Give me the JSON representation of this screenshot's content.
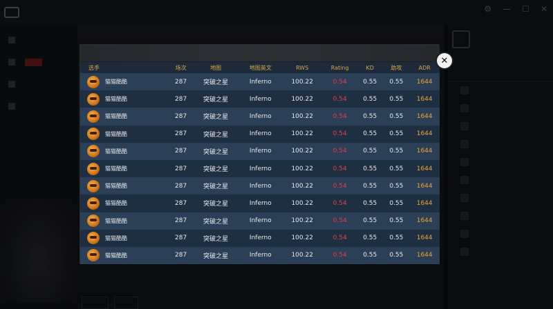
{
  "app": {
    "nav": [
      "",
      "",
      "",
      "",
      "",
      ""
    ],
    "window_controls": [
      "⚙",
      "—",
      "☐",
      "✕"
    ]
  },
  "modal": {
    "close_label": "✕",
    "columns": {
      "player": "选手",
      "matches": "场次",
      "map": "地图",
      "map_en": "地图英文",
      "rws": "RWS",
      "rating": "Rating",
      "kd": "KD",
      "assist": "助攻",
      "adr": "ADR"
    },
    "rows": [
      {
        "player": "猫猫酷酷",
        "matches": "287",
        "map": "突破之星",
        "map_en": "Inferno",
        "rws": "100.22",
        "rating": "0.54",
        "kd": "0.55",
        "assist": "0.55",
        "adr": "1644"
      },
      {
        "player": "猫猫酷酷",
        "matches": "287",
        "map": "突破之星",
        "map_en": "Inferno",
        "rws": "100.22",
        "rating": "0.54",
        "kd": "0.55",
        "assist": "0.55",
        "adr": "1644"
      },
      {
        "player": "猫猫酷酷",
        "matches": "287",
        "map": "突破之星",
        "map_en": "Inferno",
        "rws": "100.22",
        "rating": "0.54",
        "kd": "0.55",
        "assist": "0.55",
        "adr": "1644"
      },
      {
        "player": "猫猫酷酷",
        "matches": "287",
        "map": "突破之星",
        "map_en": "Inferno",
        "rws": "100.22",
        "rating": "0.54",
        "kd": "0.55",
        "assist": "0.55",
        "adr": "1644"
      },
      {
        "player": "猫猫酷酷",
        "matches": "287",
        "map": "突破之星",
        "map_en": "Inferno",
        "rws": "100.22",
        "rating": "0.54",
        "kd": "0.55",
        "assist": "0.55",
        "adr": "1644"
      },
      {
        "player": "猫猫酷酷",
        "matches": "287",
        "map": "突破之星",
        "map_en": "Inferno",
        "rws": "100.22",
        "rating": "0.54",
        "kd": "0.55",
        "assist": "0.55",
        "adr": "1644"
      },
      {
        "player": "猫猫酷酷",
        "matches": "287",
        "map": "突破之星",
        "map_en": "Inferno",
        "rws": "100.22",
        "rating": "0.54",
        "kd": "0.55",
        "assist": "0.55",
        "adr": "1644"
      },
      {
        "player": "猫猫酷酷",
        "matches": "287",
        "map": "突破之星",
        "map_en": "Inferno",
        "rws": "100.22",
        "rating": "0.54",
        "kd": "0.55",
        "assist": "0.55",
        "adr": "1644"
      },
      {
        "player": "猫猫酷酷",
        "matches": "287",
        "map": "突破之星",
        "map_en": "Inferno",
        "rws": "100.22",
        "rating": "0.54",
        "kd": "0.55",
        "assist": "0.55",
        "adr": "1644"
      },
      {
        "player": "猫猫酷酷",
        "matches": "287",
        "map": "突破之星",
        "map_en": "Inferno",
        "rws": "100.22",
        "rating": "0.54",
        "kd": "0.55",
        "assist": "0.55",
        "adr": "1644"
      },
      {
        "player": "猫猫酷酷",
        "matches": "287",
        "map": "突破之星",
        "map_en": "Inferno",
        "rws": "100.22",
        "rating": "0.54",
        "kd": "0.55",
        "assist": "0.55",
        "adr": "1644"
      }
    ]
  },
  "colors": {
    "header_text": "#d9a54a",
    "rating": "#e2404a",
    "adr": "#e8a73c",
    "row_odd": "#2b3f56",
    "row_even": "#1f2f42"
  }
}
